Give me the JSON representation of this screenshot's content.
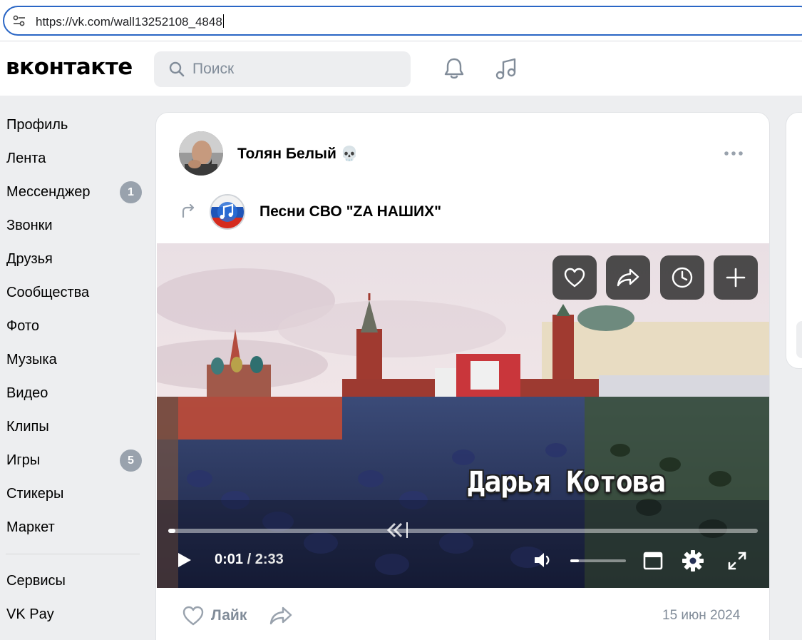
{
  "browser": {
    "url": "https://vk.com/wall13252108_4848"
  },
  "header": {
    "logo": "вконтакте",
    "search_placeholder": "Поиск"
  },
  "sidebar": {
    "items": [
      {
        "label": "Профиль"
      },
      {
        "label": "Лента"
      },
      {
        "label": "Мессенджер",
        "badge": "1"
      },
      {
        "label": "Звонки"
      },
      {
        "label": "Друзья"
      },
      {
        "label": "Сообщества"
      },
      {
        "label": "Фото"
      },
      {
        "label": "Музыка"
      },
      {
        "label": "Видео"
      },
      {
        "label": "Клипы"
      },
      {
        "label": "Игры",
        "badge": "5"
      },
      {
        "label": "Стикеры"
      },
      {
        "label": "Маркет"
      }
    ],
    "secondary": [
      {
        "label": "Сервисы"
      },
      {
        "label": "VK Pay"
      }
    ]
  },
  "post": {
    "author": "Толян Белый",
    "author_emoji": "💀",
    "repost_group": "Песни СВО \"ZA НАШИХ\"",
    "video": {
      "caption": "Дарья Котова",
      "current_time": "0:01",
      "separator": "/",
      "duration": "2:33",
      "progress_fraction": 0.007,
      "volume_fraction": 0.15,
      "action_icons": [
        "heart-icon",
        "share-icon",
        "clock-icon",
        "plus-icon"
      ]
    },
    "like_label": "Лайк",
    "date": "15 июн 2024"
  },
  "colors": {
    "accent": "#2a66c5",
    "badge": "#99a2ad",
    "muted_text": "#818c99",
    "page_bg": "#edeef0"
  }
}
